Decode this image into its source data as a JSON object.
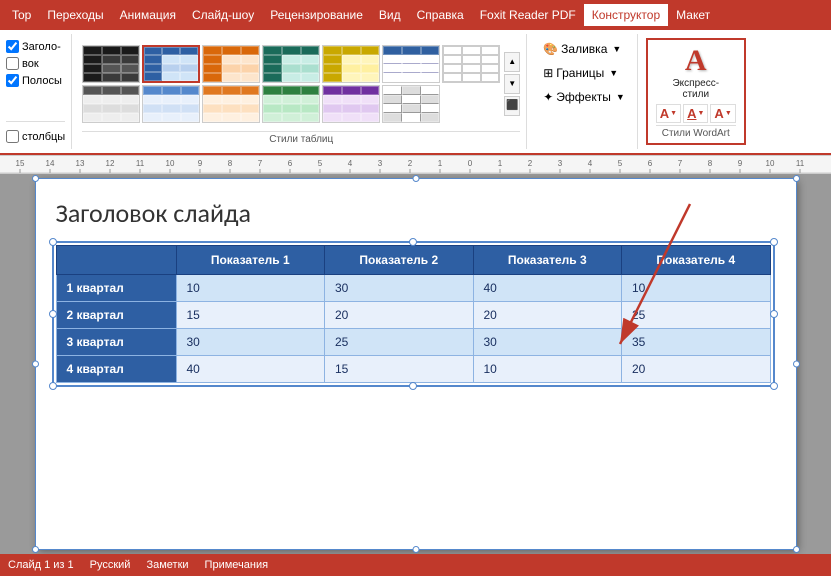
{
  "menu": {
    "items": [
      {
        "label": "Top",
        "active": false
      },
      {
        "label": "Переходы",
        "active": false
      },
      {
        "label": "Анимация",
        "active": false
      },
      {
        "label": "Слайд-шоу",
        "active": false
      },
      {
        "label": "Рецензирование",
        "active": false
      },
      {
        "label": "Вид",
        "active": false
      },
      {
        "label": "Справка",
        "active": false
      },
      {
        "label": "Foxit Reader PDF",
        "active": false
      },
      {
        "label": "Конструктор",
        "active": true
      },
      {
        "label": "Макет",
        "active": false
      }
    ]
  },
  "ribbon": {
    "table_styles_label": "Стили таблиц",
    "fill_label": "Заливка",
    "borders_label": "Границы",
    "effects_label": "Эффекты",
    "express_styles_label": "Экспресс-\nстили",
    "wordart_styles_label": "Стили WordArt"
  },
  "slide": {
    "title": "Заголовок слайда",
    "table": {
      "headers": [
        "",
        "Показатель 1",
        "Показатель 2",
        "Показатель 3",
        "Показатель 4"
      ],
      "rows": [
        [
          "1 квартал",
          "10",
          "30",
          "40",
          "10"
        ],
        [
          "2 квартал",
          "15",
          "20",
          "20",
          "25"
        ],
        [
          "3 квартал",
          "30",
          "25",
          "30",
          "35"
        ],
        [
          "4 квартал",
          "40",
          "15",
          "10",
          "20"
        ]
      ]
    }
  },
  "status": {
    "slide_info": "Слайд 1 из 1",
    "language": "Русский",
    "notes": "Заметки",
    "comments": "Примечания"
  }
}
